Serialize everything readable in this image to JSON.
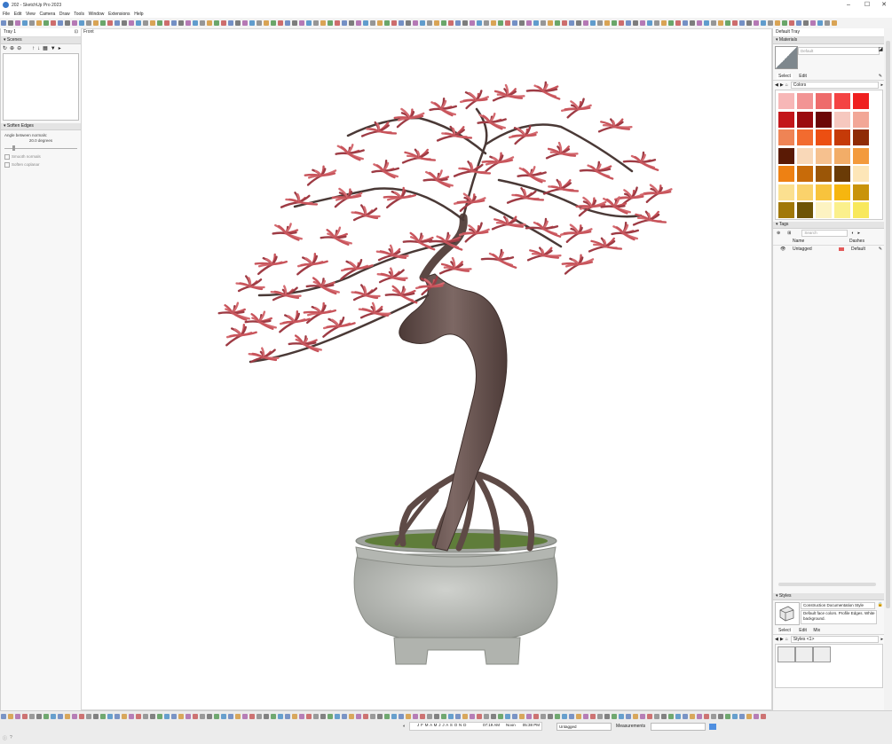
{
  "window": {
    "title": "202 - SketchUp Pro 2023",
    "minimize": "–",
    "maximize": "☐",
    "close": "✕"
  },
  "menu": [
    "File",
    "Edit",
    "View",
    "Camera",
    "Draw",
    "Tools",
    "Window",
    "Extensions",
    "Help"
  ],
  "left_tray": {
    "title": "Tray 1",
    "scenes": {
      "header": "Scenes"
    },
    "soften": {
      "header": "Soften Edges",
      "angle_label": "Angle between normals:",
      "angle_value": "20.0",
      "angle_unit": "degrees",
      "smooth_normals": "Smooth normals",
      "soften_coplanar": "Soften coplanar"
    }
  },
  "viewport": {
    "camera_label": "Front"
  },
  "right_tray": {
    "title": "Default Tray",
    "materials": {
      "header": "Materials",
      "name_value": "Default",
      "tab_select": "Select",
      "tab_edit": "Edit",
      "library": "Colors"
    },
    "tags": {
      "header": "Tags",
      "search_placeholder": "Search",
      "col_name": "Name",
      "col_dashes": "Dashes",
      "row_name": "Untagged",
      "row_dashes": "Default",
      "row_color": "#e35a5a"
    },
    "styles": {
      "header": "Styles",
      "style_name": "Construction Documentation Style",
      "style_desc": "Default face colors. Profile Edges. White background.",
      "tab_select": "Select",
      "tab_edit": "Edit",
      "tab_mix": "Mix",
      "library": "Styles <1>"
    }
  },
  "material_swatches": [
    "#f7b7b7",
    "#f29494",
    "#ee6b6b",
    "#f44343",
    "#ef1f1f",
    "#c3161a",
    "#9a0b0f",
    "#6c0707",
    "#f6c8bf",
    "#f2a797",
    "#ef8455",
    "#f26b2f",
    "#ec4f12",
    "#c53a08",
    "#8f2b05",
    "#5a1a05",
    "#f9d8b8",
    "#f6c18f",
    "#f2ad68",
    "#f39a3c",
    "#ee8113",
    "#c86b09",
    "#9b5607",
    "#6a3b06",
    "#fde6b8",
    "#fbe090",
    "#fad26b",
    "#f8c33d",
    "#f6b60f",
    "#c99309",
    "#a17808",
    "#6e5406",
    "#fdf3c2",
    "#fbf08c",
    "#f8e85c"
  ],
  "status": {
    "months": "J F M A M J J A S O N D",
    "time_left": "07:19 AM",
    "noon": "Noon",
    "time_right": "05:38 PM",
    "tag_select": "Untagged",
    "measurements_label": "Measurements",
    "measurements_value": ""
  },
  "colors": {
    "accent": "#3a78c9",
    "foliage": "#c8545b",
    "trunk": "#6b5652",
    "pot": "#b9bbb7"
  }
}
